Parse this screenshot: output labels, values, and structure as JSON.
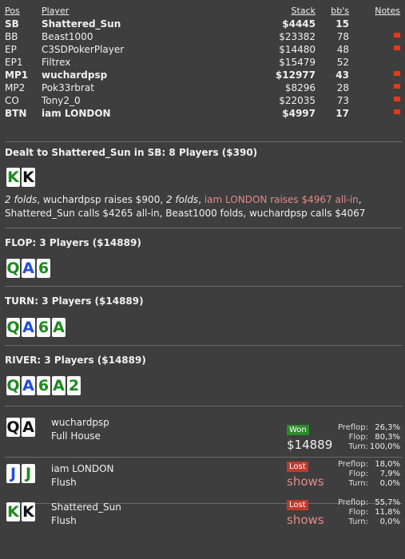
{
  "header": {
    "pos": "Pos",
    "player": "Player",
    "stack": "Stack",
    "bbs": "bb's",
    "notes": "Notes"
  },
  "players": [
    {
      "pos": "SB",
      "name": "Shattered_Sun",
      "stack": "$4445",
      "bbs": "15",
      "bold": true,
      "flag": false
    },
    {
      "pos": "BB",
      "name": "Beast1000",
      "stack": "$23382",
      "bbs": "78",
      "bold": false,
      "flag": true
    },
    {
      "pos": "EP",
      "name": "C3SDPokerPlayer",
      "stack": "$14480",
      "bbs": "48",
      "bold": false,
      "flag": true
    },
    {
      "pos": "EP1",
      "name": "Filtrex",
      "stack": "$15479",
      "bbs": "52",
      "bold": false,
      "flag": false
    },
    {
      "pos": "MP1",
      "name": "wuchardpsp",
      "stack": "$12977",
      "bbs": "43",
      "bold": true,
      "flag": true
    },
    {
      "pos": "MP2",
      "name": "Pok33rbrat",
      "stack": "$8296",
      "bbs": "28",
      "bold": false,
      "flag": true
    },
    {
      "pos": "CO",
      "name": "Tony2_0",
      "stack": "$22035",
      "bbs": "73",
      "bold": false,
      "flag": true
    },
    {
      "pos": "BTN",
      "name": "iam LONDON",
      "stack": "$4997",
      "bbs": "17",
      "bold": true,
      "flag": true
    }
  ],
  "dealt": {
    "text": "Dealt to Shattered_Sun in SB: 8 Players ($390)",
    "cards": [
      {
        "r": "K",
        "s": "c"
      },
      {
        "r": "K",
        "s": "s"
      }
    ]
  },
  "preflop_action": [
    {
      "t": "2 folds",
      "style": "it"
    },
    {
      "t": ", wuchardpsp raises $900, ",
      "style": ""
    },
    {
      "t": "2 folds",
      "style": "it"
    },
    {
      "t": ", ",
      "style": ""
    },
    {
      "t": "iam LONDON raises $4967 all-in",
      "style": "red"
    },
    {
      "t": ", Shattered_Sun calls $4265 all-in, Beast1000 folds, wuchardpsp calls $4067",
      "style": ""
    }
  ],
  "streets": [
    {
      "label": "FLOP: 3 Players ($14889)",
      "cards": [
        {
          "r": "Q",
          "s": "c"
        },
        {
          "r": "A",
          "s": "d"
        },
        {
          "r": "6",
          "s": "c"
        }
      ]
    },
    {
      "label": "TURN: 3 Players ($14889)",
      "cards": [
        {
          "r": "Q",
          "s": "c"
        },
        {
          "r": "A",
          "s": "d"
        },
        {
          "r": "6",
          "s": "c"
        },
        {
          "r": "A",
          "s": "c"
        }
      ]
    },
    {
      "label": "RIVER: 3 Players ($14889)",
      "cards": [
        {
          "r": "Q",
          "s": "c"
        },
        {
          "r": "A",
          "s": "d"
        },
        {
          "r": "6",
          "s": "c"
        },
        {
          "r": "A",
          "s": "c"
        },
        {
          "r": "2",
          "s": "c"
        }
      ]
    }
  ],
  "results": [
    {
      "name": "wuchardpsp",
      "hand": "Full House",
      "badge": "Won",
      "result_kind": "won",
      "amount": "$14889",
      "cards": [
        {
          "r": "Q",
          "s": "s"
        },
        {
          "r": "A",
          "s": "s"
        }
      ],
      "stats": [
        {
          "l": "Preflop:",
          "v": "26,3%"
        },
        {
          "l": "Flop:",
          "v": "80,3%"
        },
        {
          "l": "Turn:",
          "v": "100,0%"
        }
      ]
    },
    {
      "name": "iam LONDON",
      "hand": "Flush",
      "badge": "Lost",
      "result_kind": "lost",
      "amount": "shows",
      "cards": [
        {
          "r": "J",
          "s": "d"
        },
        {
          "r": "J",
          "s": "c"
        }
      ],
      "stats": [
        {
          "l": "Preflop:",
          "v": "18,0%"
        },
        {
          "l": "Flop:",
          "v": "7,9%"
        },
        {
          "l": "Turn:",
          "v": "0,0%"
        }
      ]
    },
    {
      "name": "Shattered_Sun",
      "hand": "Flush",
      "badge": "Lost",
      "result_kind": "lost",
      "amount": "shows",
      "cards": [
        {
          "r": "K",
          "s": "c"
        },
        {
          "r": "K",
          "s": "s"
        }
      ],
      "stats": [
        {
          "l": "Preflop:",
          "v": "55,7%"
        },
        {
          "l": "Flop:",
          "v": "11,8%"
        },
        {
          "l": "Turn:",
          "v": "0,0%"
        }
      ]
    }
  ]
}
